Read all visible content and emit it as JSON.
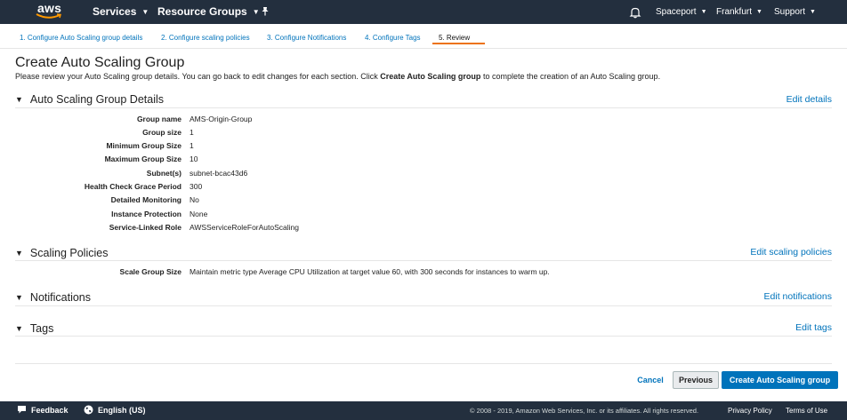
{
  "topnav": {
    "logo_text": "aws",
    "services_label": "Services",
    "resource_groups_label": "Resource Groups",
    "account_label": "Spaceport",
    "region_label": "Frankfurt",
    "support_label": "Support"
  },
  "wizard": {
    "steps": [
      "1. Configure Auto Scaling group details",
      "2. Configure scaling policies",
      "3. Configure Notifications",
      "4. Configure Tags",
      "5. Review"
    ],
    "active_step": 5
  },
  "page": {
    "title": "Create Auto Scaling Group",
    "intro_before": "Please review your Auto Scaling group details. You can go back to edit changes for each section. Click ",
    "intro_bold": "Create Auto Scaling group",
    "intro_after": " to complete the creation of an Auto Scaling group."
  },
  "details": {
    "heading": "Auto Scaling Group Details",
    "edit_label": "Edit details",
    "rows": [
      {
        "label": "Group name",
        "value": "AMS-Origin-Group"
      },
      {
        "label": "Group size",
        "value": "1"
      },
      {
        "label": "Minimum Group Size",
        "value": "1"
      },
      {
        "label": "Maximum Group Size",
        "value": "10"
      },
      {
        "label": "Subnet(s)",
        "value": "subnet-bcac43d6"
      },
      {
        "label": "Health Check Grace Period",
        "value": "300"
      },
      {
        "label": "Detailed Monitoring",
        "value": "No"
      },
      {
        "label": "Instance Protection",
        "value": "None"
      },
      {
        "label": "Service-Linked Role",
        "value": "AWSServiceRoleForAutoScaling"
      }
    ]
  },
  "policies": {
    "heading": "Scaling Policies",
    "edit_label": "Edit scaling policies",
    "rows": [
      {
        "label": "Scale Group Size",
        "value": "Maintain metric type Average CPU Utilization at target value 60, with 300 seconds for instances to warm up."
      }
    ]
  },
  "notifications": {
    "heading": "Notifications",
    "edit_label": "Edit notifications"
  },
  "tags": {
    "heading": "Tags",
    "edit_label": "Edit tags"
  },
  "actions": {
    "cancel_label": "Cancel",
    "previous_label": "Previous",
    "create_label": "Create Auto Scaling group"
  },
  "footer": {
    "feedback_label": "Feedback",
    "language_label": "English (US)",
    "copyright": "© 2008 - 2019, Amazon Web Services, Inc. or its affiliates. All rights reserved.",
    "privacy_label": "Privacy Policy",
    "terms_label": "Terms of Use"
  },
  "colors": {
    "nav_bg": "#232f3e",
    "link": "#0073bb",
    "accent": "#ec7211",
    "primary_button": "#0073bb"
  }
}
